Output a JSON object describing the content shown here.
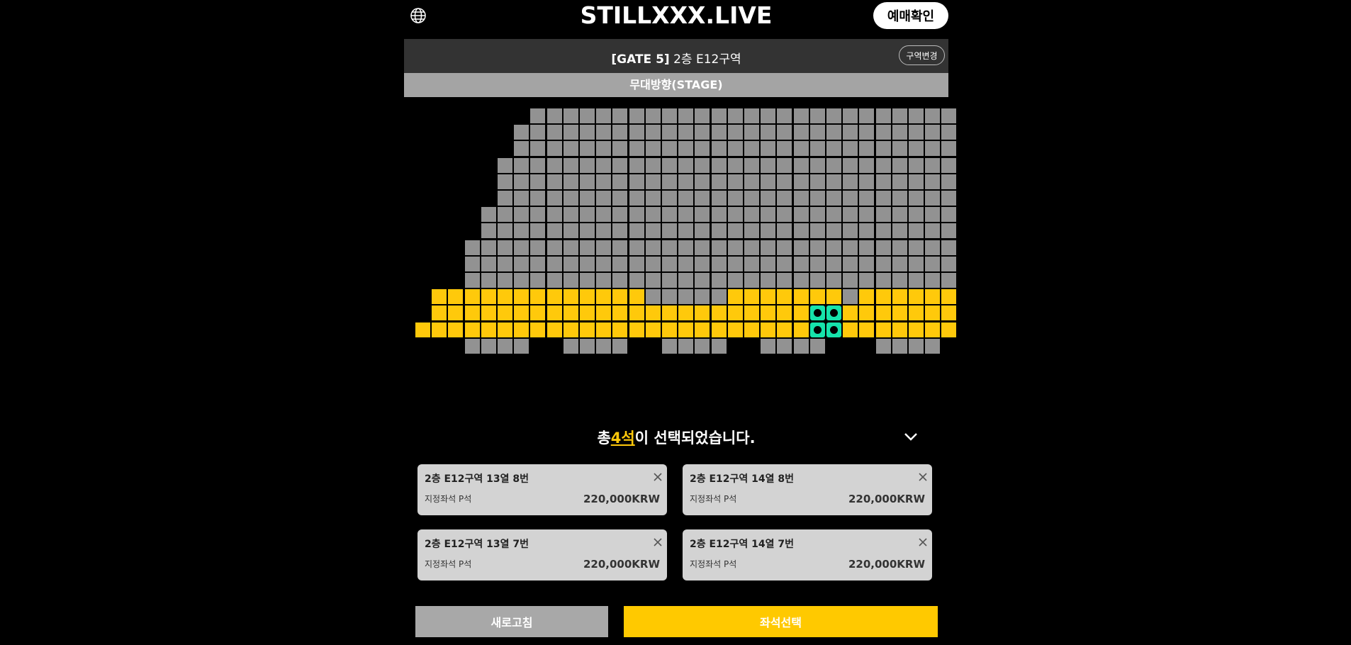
{
  "header": {
    "logo": "STILLXXX.LIVE",
    "confirm_button": "예매확인",
    "globe_icon": "globe-icon"
  },
  "zone": {
    "gate": "[GATE 5]",
    "name": "2층 E12구역",
    "change_button": "구역변경"
  },
  "stage_label": "무대방향(STAGE)",
  "colors": {
    "available": "#ffc90b",
    "unavailable": "#929292",
    "selected": "#16e3ab",
    "accent": "#ffc900"
  },
  "seat_rows": [
    {
      "gray": [
        [
          7,
          32
        ]
      ]
    },
    {
      "gray": [
        [
          6,
          32
        ]
      ]
    },
    {
      "gray": [
        [
          6,
          32
        ]
      ]
    },
    {
      "gray": [
        [
          5,
          32
        ]
      ]
    },
    {
      "gray": [
        [
          5,
          32
        ]
      ]
    },
    {
      "gray": [
        [
          5,
          32
        ]
      ]
    },
    {
      "gray": [
        [
          4,
          32
        ]
      ]
    },
    {
      "gray": [
        [
          4,
          32
        ]
      ]
    },
    {
      "gray": [
        [
          3,
          32
        ]
      ]
    },
    {
      "gray": [
        [
          3,
          32
        ]
      ]
    },
    {
      "gray": [
        [
          3,
          32
        ]
      ]
    },
    {
      "yellow": [
        [
          1,
          13
        ],
        [
          19,
          25
        ],
        [
          27,
          32
        ]
      ],
      "gray": [
        [
          14,
          18
        ],
        [
          26,
          26
        ]
      ]
    },
    {
      "yellow": [
        [
          1,
          23
        ],
        [
          26,
          32
        ]
      ],
      "selected": [
        [
          24,
          25
        ]
      ]
    },
    {
      "yellow": [
        [
          0,
          23
        ],
        [
          26,
          32
        ]
      ],
      "selected": [
        [
          24,
          25
        ]
      ]
    },
    {
      "gray": [
        [
          3,
          6
        ],
        [
          9,
          12
        ],
        [
          15,
          18
        ],
        [
          21,
          24
        ],
        [
          28,
          31
        ]
      ]
    }
  ],
  "summary": {
    "prefix": "총",
    "count": "4석",
    "suffix": "이 선택되었습니다."
  },
  "selected_seats": [
    {
      "title": "2층 E12구역 13열 8번",
      "type": "지정좌석 P석",
      "price": "220,000KRW"
    },
    {
      "title": "2층 E12구역 14열 8번",
      "type": "지정좌석 P석",
      "price": "220,000KRW"
    },
    {
      "title": "2층 E12구역 13열 7번",
      "type": "지정좌석 P석",
      "price": "220,000KRW"
    },
    {
      "title": "2층 E12구역 14열 7번",
      "type": "지정좌석 P석",
      "price": "220,000KRW"
    }
  ],
  "buttons": {
    "refresh": "새로고침",
    "select": "좌석선택"
  }
}
